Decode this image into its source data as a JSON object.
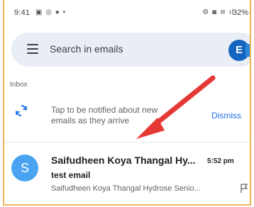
{
  "status_bar": {
    "time": "9:41",
    "left_icons": "▣ ◎ ● •",
    "right_icons": "⚙ ◙ ≋ ıl",
    "battery": "32%"
  },
  "search": {
    "placeholder": "Search in emails"
  },
  "section": {
    "label": "Inbox"
  },
  "notification": {
    "text": "Tap to be notified about new emails as they arrive",
    "dismiss_label": "Dismiss"
  },
  "email": {
    "avatar_letter": "S",
    "sender": "Saifudheen Koya Thangal Hy...",
    "time": "5:52 pm",
    "subject": "test email",
    "snippet": "Saifudheen Koya Thangal Hydrose Senio..."
  },
  "colors": {
    "accent": "#1a73e8",
    "avatar": "#4aa3f0",
    "arrow": "#e53935",
    "frame_border": "#f0b35a"
  },
  "icons": {
    "menu": "hamburger-menu-icon",
    "account": "outlook-icon",
    "sync": "sync-icon",
    "flag": "flag-icon"
  }
}
